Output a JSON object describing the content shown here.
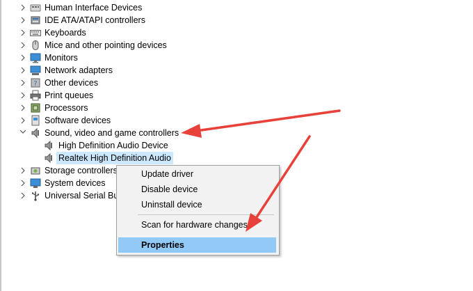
{
  "tree": {
    "human_interface": "Human Interface Devices",
    "ide": "IDE ATA/ATAPI controllers",
    "keyboards": "Keyboards",
    "mice": "Mice and other pointing devices",
    "monitors": "Monitors",
    "network": "Network adapters",
    "other": "Other devices",
    "print": "Print queues",
    "processors": "Processors",
    "software": "Software devices",
    "sound": "Sound, video and game controllers",
    "sound_children": [
      "High Definition Audio Device",
      "Realtek High Definition Audio"
    ],
    "storage": "Storage controllers",
    "system": "System devices",
    "usb": "Universal Serial Bus"
  },
  "context_menu": {
    "update": "Update driver",
    "disable": "Disable device",
    "uninstall": "Uninstall device",
    "scan": "Scan for hardware changes",
    "properties": "Properties"
  },
  "colors": {
    "selection": "#cce8ff",
    "menu_highlight": "#91c9f7",
    "arrow": "#e8413a"
  },
  "icons": [
    "hid-icon",
    "ide-icon",
    "keyboard-icon",
    "mouse-icon",
    "monitor-icon",
    "network-icon",
    "unknown-device-icon",
    "printer-icon",
    "processor-icon",
    "software-device-icon",
    "speaker-icon",
    "storage-icon",
    "system-icon",
    "usb-icon"
  ]
}
